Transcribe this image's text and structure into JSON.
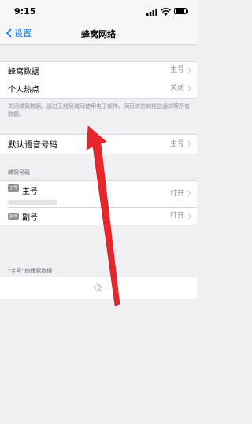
{
  "status_bar": {
    "time": "9:15"
  },
  "nav": {
    "back_label": "设置",
    "title": "蜂窝网络"
  },
  "group1": {
    "rows": [
      {
        "label": "蜂窝数据",
        "value": "主号"
      },
      {
        "label": "个人热点",
        "value": "关闭"
      }
    ],
    "footnote": "关闭蜂窝数据，通过无线局域网使用电子邮件、网页浏览和推送通知等所有数据。"
  },
  "voice": {
    "label": "默认语音号码",
    "value": "主号"
  },
  "lines": {
    "header": "蜂窝号码",
    "items": [
      {
        "badge": "主号",
        "label": "主号",
        "value": "打开"
      },
      {
        "badge": "副号",
        "label": "副号",
        "value": "打开"
      }
    ]
  },
  "data_section": {
    "header": "“主号”的蜂窝数据"
  },
  "colors": {
    "accent": "#007aff",
    "annotation_arrow": "#e8252b"
  }
}
